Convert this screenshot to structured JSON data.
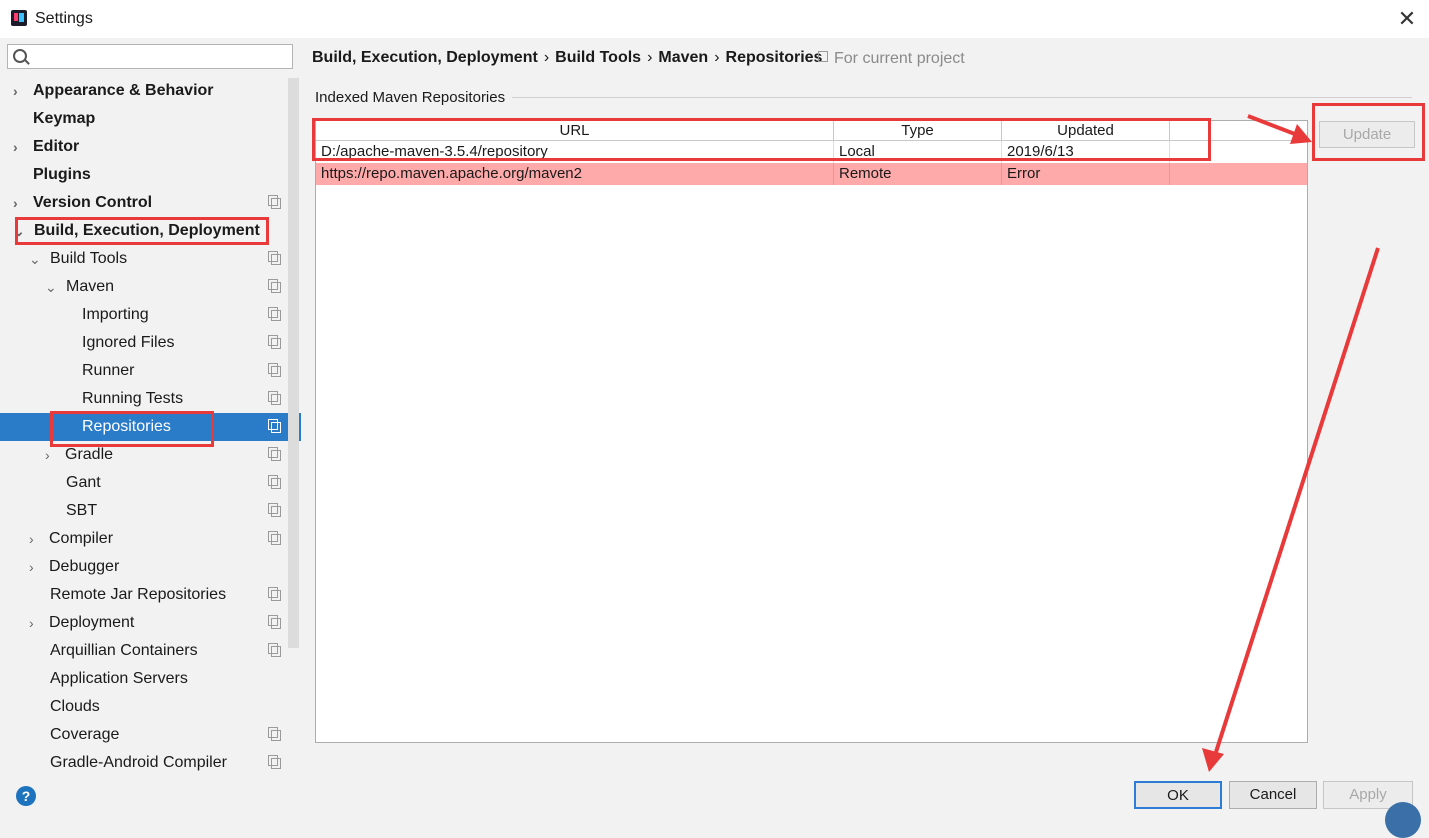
{
  "window": {
    "title": "Settings",
    "close_glyph": "✕"
  },
  "search": {
    "placeholder": "",
    "icon": "search-icon"
  },
  "sidebar": {
    "items": [
      {
        "label": "Appearance & Behavior",
        "bold": true,
        "arrow": "›",
        "copy": false
      },
      {
        "label": "Keymap",
        "bold": true,
        "arrow": "",
        "copy": false
      },
      {
        "label": "Editor",
        "bold": true,
        "arrow": "›",
        "copy": false
      },
      {
        "label": "Plugins",
        "bold": true,
        "arrow": "",
        "copy": false
      },
      {
        "label": "Version Control",
        "bold": true,
        "arrow": "›",
        "copy": true
      },
      {
        "label": "Build, Execution, Deployment",
        "bold": true,
        "arrow": "⌄",
        "copy": false
      },
      {
        "label": "Build Tools",
        "bold": false,
        "arrow": "⌄",
        "copy": true
      },
      {
        "label": "Maven",
        "bold": false,
        "arrow": "⌄",
        "copy": true
      },
      {
        "label": "Importing",
        "bold": false,
        "arrow": "",
        "copy": true
      },
      {
        "label": "Ignored Files",
        "bold": false,
        "arrow": "",
        "copy": true
      },
      {
        "label": "Runner",
        "bold": false,
        "arrow": "",
        "copy": true
      },
      {
        "label": "Running Tests",
        "bold": false,
        "arrow": "",
        "copy": true
      },
      {
        "label": "Repositories",
        "bold": false,
        "arrow": "",
        "copy": true,
        "selected": true
      },
      {
        "label": "Gradle",
        "bold": false,
        "arrow": "›",
        "copy": true
      },
      {
        "label": "Gant",
        "bold": false,
        "arrow": "",
        "copy": true
      },
      {
        "label": "SBT",
        "bold": false,
        "arrow": "",
        "copy": true
      },
      {
        "label": "Compiler",
        "bold": false,
        "arrow": "›",
        "copy": true
      },
      {
        "label": "Debugger",
        "bold": false,
        "arrow": "›",
        "copy": false
      },
      {
        "label": "Remote Jar Repositories",
        "bold": false,
        "arrow": "",
        "copy": true
      },
      {
        "label": "Deployment",
        "bold": false,
        "arrow": "›",
        "copy": true
      },
      {
        "label": "Arquillian Containers",
        "bold": false,
        "arrow": "",
        "copy": true
      },
      {
        "label": "Application Servers",
        "bold": false,
        "arrow": "",
        "copy": false
      },
      {
        "label": "Clouds",
        "bold": false,
        "arrow": "",
        "copy": false
      },
      {
        "label": "Coverage",
        "bold": false,
        "arrow": "",
        "copy": true
      },
      {
        "label": "Gradle-Android Compiler",
        "bold": false,
        "arrow": "",
        "copy": true
      }
    ]
  },
  "breadcrumb": {
    "parts": [
      "Build, Execution, Deployment",
      "Build Tools",
      "Maven",
      "Repositories"
    ],
    "separator": "›",
    "note": "For current project"
  },
  "group": {
    "title": "Indexed Maven Repositories"
  },
  "table": {
    "headers": [
      "URL",
      "Type",
      "Updated",
      ""
    ],
    "rows": [
      {
        "url": "D:/apache-maven-3.5.4/repository",
        "type": "Local",
        "updated": "2019/6/13",
        "status": "ok"
      },
      {
        "url": "https://repo.maven.apache.org/maven2",
        "type": "Remote",
        "updated": "Error",
        "status": "error"
      }
    ]
  },
  "buttons": {
    "update": "Update",
    "ok": "OK",
    "cancel": "Cancel",
    "apply": "Apply",
    "help": "?"
  },
  "colors": {
    "selection": "#2a7bc8",
    "error_row": "#ffaaaa",
    "annotation": "#e83a3a",
    "ok_border": "#2d7cd6"
  }
}
